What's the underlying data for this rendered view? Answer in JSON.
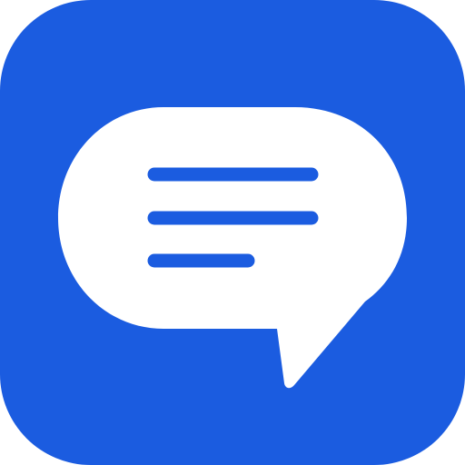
{
  "icon": {
    "name": "chat-bubble-icon",
    "background_color": "#1b5ce0",
    "bubble_color": "#ffffff",
    "line_color": "#1b5ce0"
  }
}
